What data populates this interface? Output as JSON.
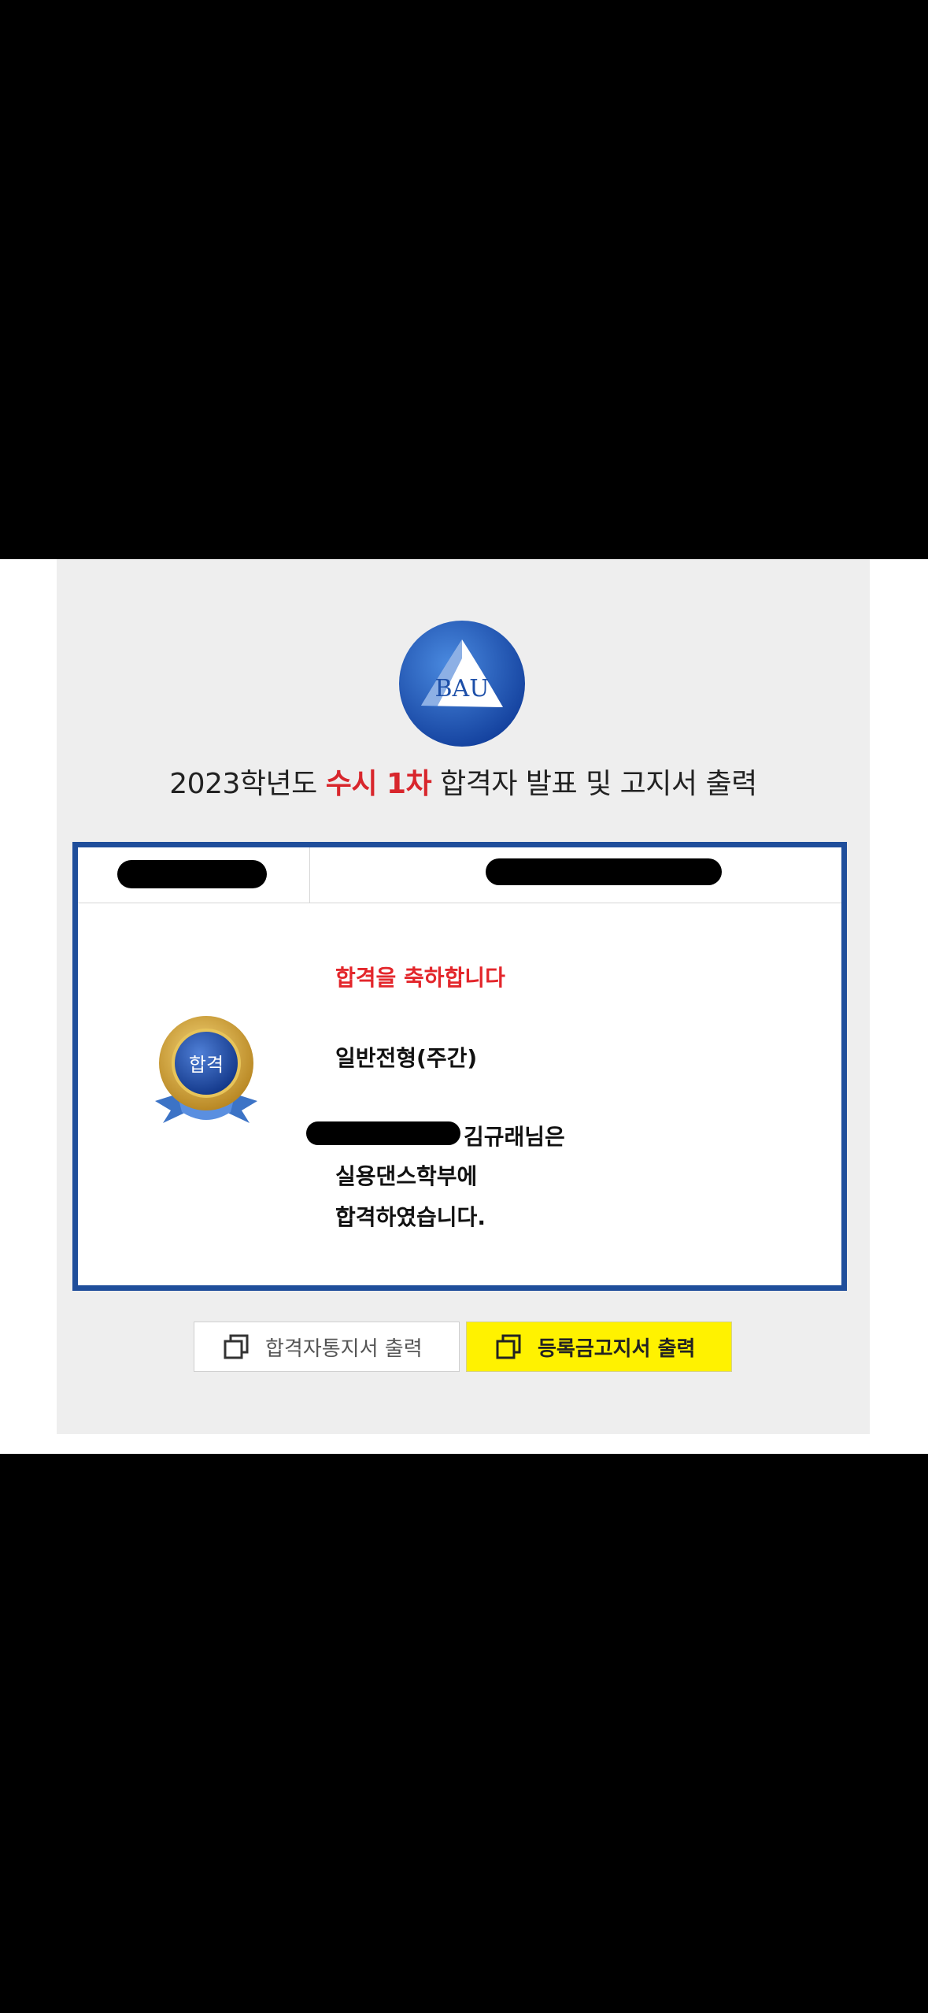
{
  "logo": {
    "text": "BAU"
  },
  "title": {
    "prefix": "2023학년도 ",
    "highlight": "수시 1차",
    "suffix": " 합격자 발표 및 고지서 출력"
  },
  "result": {
    "badge_text": "합격",
    "congrats": "합격을 축하합니다",
    "admission_type": "일반전형(주간)",
    "name_line": "김규래님은",
    "department_line": "실용댄스학부에",
    "result_line": "합격하였습니다."
  },
  "buttons": {
    "notice_label": "합격자통지서 출력",
    "fee_label": "등록금고지서 출력"
  },
  "colors": {
    "accent_red": "#d8262c",
    "box_border": "#1f4e9b",
    "fee_button": "#fff200"
  }
}
